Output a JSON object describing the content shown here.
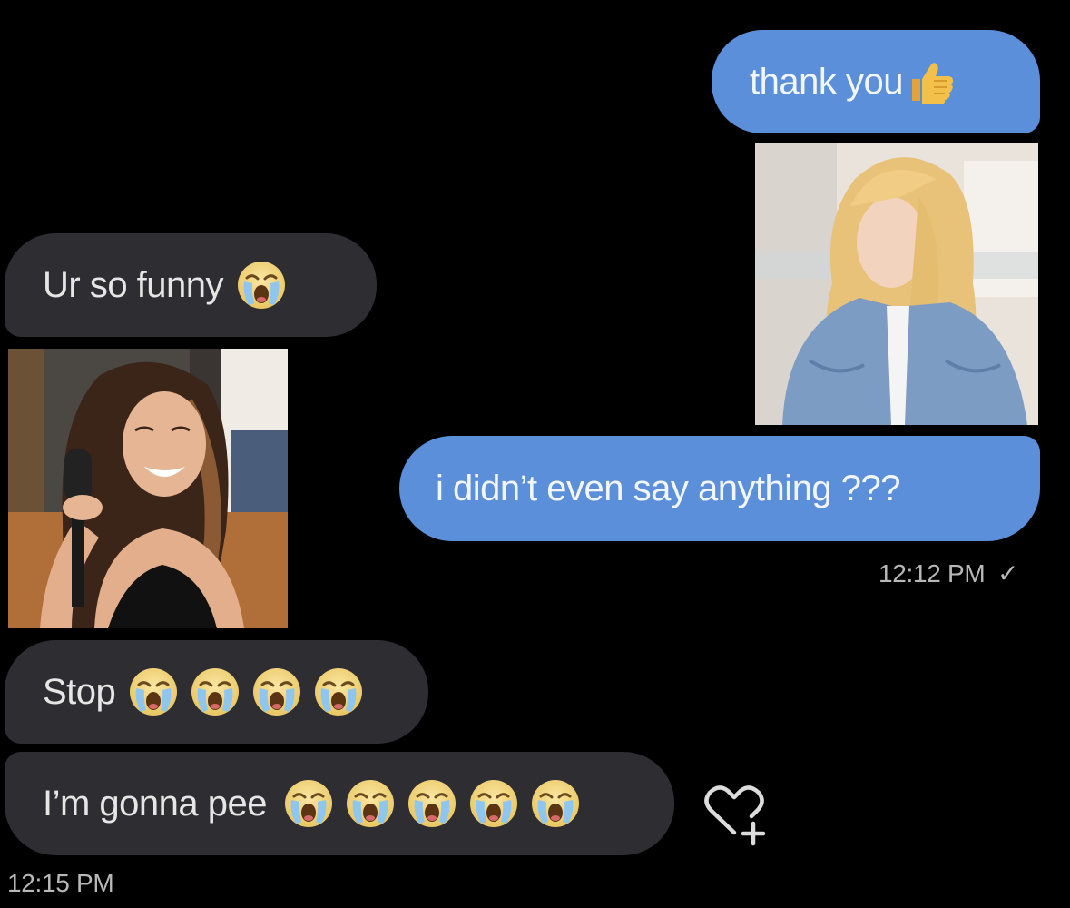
{
  "messages": {
    "m1": {
      "text": "thank you",
      "emoji": "thumbs-up-icon"
    },
    "m2": {
      "text": "Ur so funny",
      "emoji": "loudly-crying-face-icon",
      "emoji_count": 1
    },
    "m3": {
      "text": "i didn’t even say anything ???"
    },
    "m4": {
      "text": "Stop",
      "emoji": "loudly-crying-face-icon",
      "emoji_count": 4
    },
    "m5": {
      "text": "I’m gonna pee",
      "emoji": "loudly-crying-face-icon",
      "emoji_count": 5
    }
  },
  "timestamps": {
    "sent": "12:12 PM",
    "sent_status": "✓",
    "received": "12:15 PM"
  },
  "photos": {
    "sent_photo": "blonde-woman-denim-jacket-photo",
    "received_photo": "woman-laughing-with-microphone-photo"
  },
  "actions": {
    "react": "heart-plus-icon"
  },
  "colors": {
    "background": "#000000",
    "sent_bubble": "#5b8fd9",
    "received_bubble": "#2e2e32",
    "timestamp": "#b8b8b8"
  }
}
